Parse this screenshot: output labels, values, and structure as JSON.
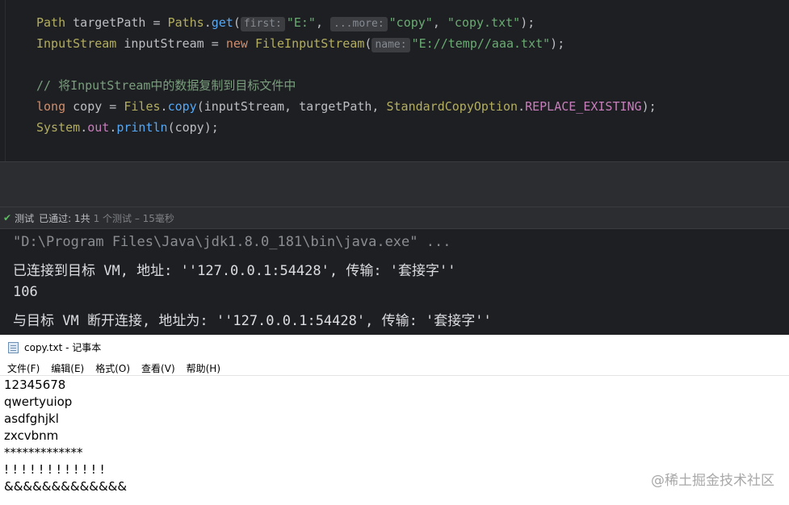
{
  "editor": {
    "line1": {
      "type": "Path",
      "var": " targetPath = ",
      "cls": "Paths",
      "dot": ".",
      "method": "get",
      "open": "(",
      "hint1": "first:",
      "arg1": "\"E:\"",
      "comma1": ", ",
      "hint2": "...more:",
      "arg2": "\"copy\"",
      "comma2": ", ",
      "arg3": "\"copy.txt\"",
      "close": ");"
    },
    "line2": {
      "type": "InputStream",
      "var": " inputStream = ",
      "kw": "new",
      "sp": " ",
      "cls": "FileInputStream",
      "open": "(",
      "hint": "name:",
      "arg": "\"E://temp//aaa.txt\"",
      "close": ");"
    },
    "line3_comment": "// 将InputStream中的数据复制到目标文件中",
    "line4": {
      "kw": "long",
      "var": " copy = ",
      "cls": "Files",
      "dot": ".",
      "method": "copy",
      "args": "(inputStream, targetPath, ",
      "cls2": "StandardCopyOption",
      "dot2": ".",
      "const": "REPLACE_EXISTING",
      "close": ");"
    },
    "line5": {
      "cls": "System",
      "dot": ".",
      "field": "out",
      "dot2": ".",
      "method": "println",
      "args": "(copy);"
    }
  },
  "test_status": {
    "label": "测试",
    "passed": "已通过: 1共",
    "detail": "1 个测试 – 15毫秒"
  },
  "console": {
    "lines": [
      "\"D:\\Program Files\\Java\\jdk1.8.0_181\\bin\\java.exe\" ...",
      "已连接到目标 VM, 地址: ''127.0.0.1:54428', 传输: '套接字''",
      "106",
      "与目标 VM 断开连接, 地址为: ''127.0.0.1:54428', 传输: '套接字''"
    ]
  },
  "notepad": {
    "title": "copy.txt - 记事本",
    "menu": [
      "文件(F)",
      "编辑(E)",
      "格式(O)",
      "查看(V)",
      "帮助(H)"
    ],
    "content": [
      "12345678",
      "qwertyuiop",
      "asdfghjkl",
      "zxcvbnm",
      "*************",
      "! ! ! ! ! ! ! ! ! ! ! !",
      "&&&&&&&&&&&&&"
    ]
  },
  "watermark": "@稀土掘金技术社区"
}
